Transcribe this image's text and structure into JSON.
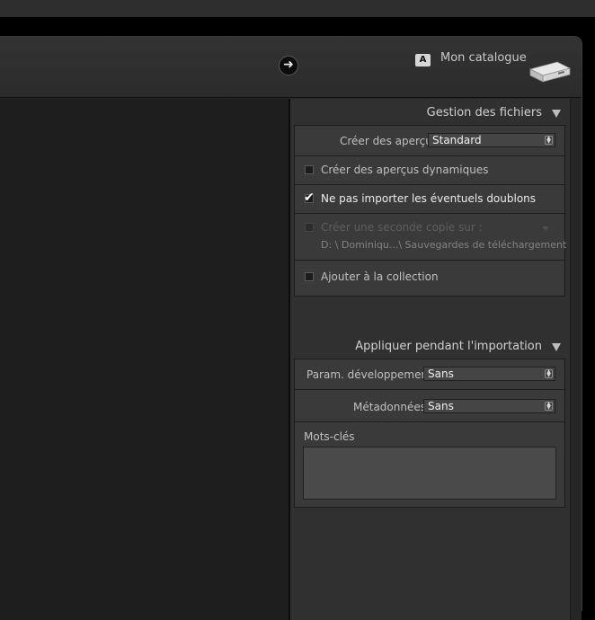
{
  "header": {
    "catalog_badge": "A",
    "catalog_name": "Mon catalogue"
  },
  "file_handling": {
    "title": "Gestion des fichiers",
    "previews_label": "Créer des aperçus",
    "previews_value": "Standard",
    "smart_previews_label": "Créer des aperçus dynamiques",
    "smart_previews_checked": false,
    "no_duplicates_label": "Ne pas importer les éventuels doublons",
    "no_duplicates_checked": true,
    "second_copy_label": "Créer une seconde copie sur :",
    "second_copy_checked": false,
    "second_copy_path": "D: \\ Dominiqu...\\ Sauvegardes de téléchargement",
    "add_collection_label": "Ajouter à la collection",
    "add_collection_checked": false
  },
  "apply_during_import": {
    "title": "Appliquer pendant l'importation",
    "develop_label": "Param. développement",
    "develop_value": "Sans",
    "metadata_label": "Métadonnées",
    "metadata_value": "Sans",
    "keywords_label": "Mots-clés",
    "keywords_value": ""
  },
  "colors": {
    "panel_bg": "#303030",
    "group_bg": "#3a3a3a",
    "text": "#c0c0c0",
    "text_highlight": "#ececec"
  },
  "icons": [
    "arrow-right-icon",
    "collapse-triangle-icon",
    "drive-icon",
    "checkmark-icon",
    "stepper-icon"
  ]
}
